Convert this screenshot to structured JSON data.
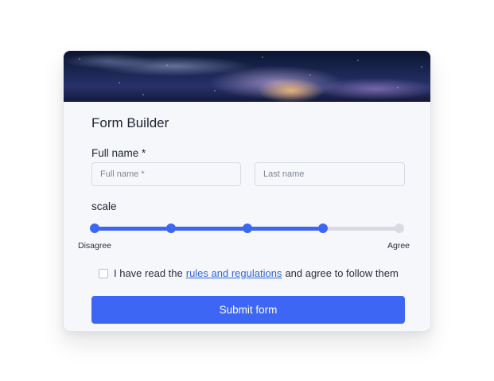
{
  "form": {
    "title": "Form Builder",
    "full_name_label": "Full name *",
    "first_name_placeholder": "Full name *",
    "last_name_placeholder": "Last name",
    "scale_label": "scale",
    "scale": {
      "min_label": "Disagree",
      "max_label": "Agree",
      "steps": 5,
      "selected_step": 4,
      "fill_fraction": 0.75
    },
    "terms": {
      "prefix": "I have read the",
      "link_text": "rules and regulations",
      "suffix": "and agree to follow them",
      "checked": false
    },
    "submit_label": "Submit form"
  },
  "colors": {
    "accent": "#3e66f5",
    "track": "#d9dbe2",
    "link": "#2f65e0",
    "card_bg": "#f6f7fb"
  },
  "icons": {
    "banner": "milky-way-banner-image",
    "checkbox": "checkbox-unchecked"
  }
}
